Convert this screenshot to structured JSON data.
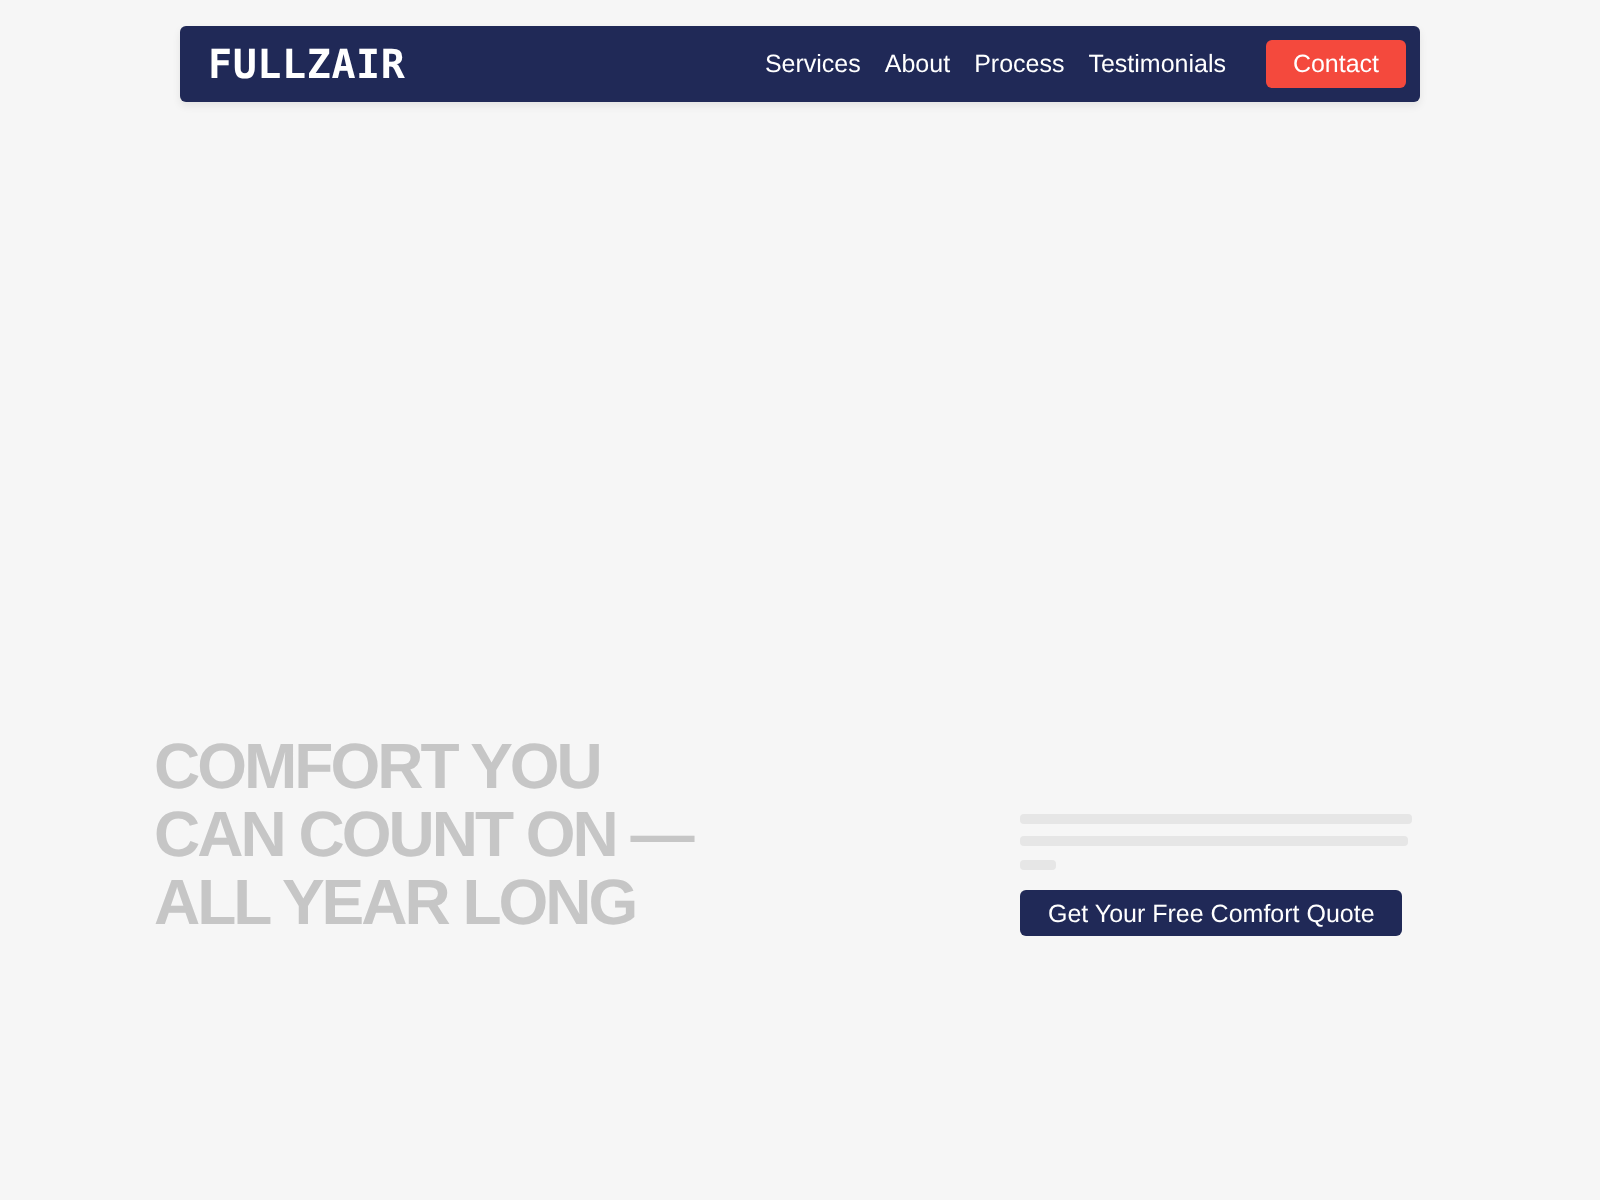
{
  "nav": {
    "logo": "FULLZAIR",
    "links": [
      "Services",
      "About",
      "Process",
      "Testimonials"
    ],
    "cta": "Contact"
  },
  "hero": {
    "heading": "COMFORT YOU\nCAN COUNT ON —\nALL YEAR LONG",
    "button": "Get Your Free Comfort Quote"
  }
}
